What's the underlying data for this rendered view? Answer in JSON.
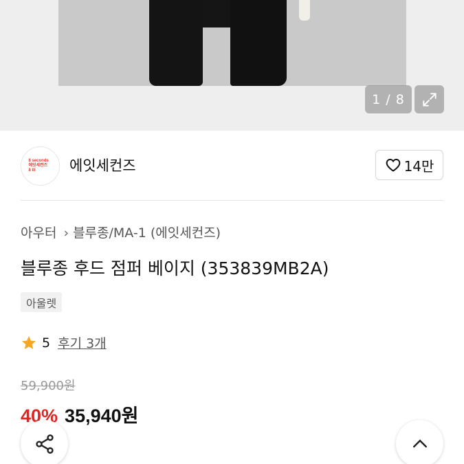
{
  "gallery": {
    "counter": "1 / 8"
  },
  "brand": {
    "name": "에잇세컨즈",
    "logo_lines": [
      "8 seconds",
      "에잇세컨즈",
      "8 III"
    ],
    "like_count": "14만"
  },
  "category": {
    "parent": "아우터",
    "child": "블루종/MA-1 (에잇세컨즈)"
  },
  "product": {
    "title": "블루종 후드 점퍼 베이지 (353839MB2A)",
    "badge": "아울렛",
    "rating": "5",
    "reviews": "후기 3개",
    "original_price": "59,900원",
    "discount": "40%",
    "price": "35,940원"
  },
  "colors": {
    "accent": "#e12424",
    "star": "#f5a623",
    "logo": "#e03a2f"
  },
  "icons": [
    "expand-icon",
    "heart-icon",
    "chevron-right-icon",
    "star-icon",
    "share-icon",
    "chevron-up-icon"
  ]
}
